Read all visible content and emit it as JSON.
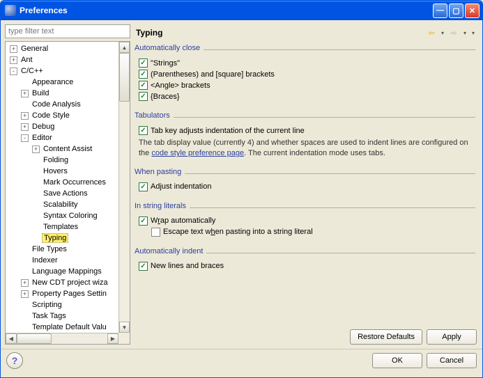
{
  "window": {
    "title": "Preferences"
  },
  "filter": {
    "placeholder": "type filter text"
  },
  "tree": [
    {
      "depth": 0,
      "tw": "+",
      "label": "General"
    },
    {
      "depth": 0,
      "tw": "+",
      "label": "Ant"
    },
    {
      "depth": 0,
      "tw": "-",
      "label": "C/C++"
    },
    {
      "depth": 1,
      "tw": " ",
      "label": "Appearance"
    },
    {
      "depth": 1,
      "tw": "+",
      "label": "Build"
    },
    {
      "depth": 1,
      "tw": " ",
      "label": "Code Analysis"
    },
    {
      "depth": 1,
      "tw": "+",
      "label": "Code Style"
    },
    {
      "depth": 1,
      "tw": "+",
      "label": "Debug"
    },
    {
      "depth": 1,
      "tw": "-",
      "label": "Editor"
    },
    {
      "depth": 2,
      "tw": "+",
      "label": "Content Assist"
    },
    {
      "depth": 2,
      "tw": " ",
      "label": "Folding"
    },
    {
      "depth": 2,
      "tw": " ",
      "label": "Hovers"
    },
    {
      "depth": 2,
      "tw": " ",
      "label": "Mark Occurrences"
    },
    {
      "depth": 2,
      "tw": " ",
      "label": "Save Actions"
    },
    {
      "depth": 2,
      "tw": " ",
      "label": "Scalability"
    },
    {
      "depth": 2,
      "tw": " ",
      "label": "Syntax Coloring"
    },
    {
      "depth": 2,
      "tw": " ",
      "label": "Templates"
    },
    {
      "depth": 2,
      "tw": " ",
      "label": "Typing",
      "selected": true
    },
    {
      "depth": 1,
      "tw": " ",
      "label": "File Types"
    },
    {
      "depth": 1,
      "tw": " ",
      "label": "Indexer"
    },
    {
      "depth": 1,
      "tw": " ",
      "label": "Language Mappings"
    },
    {
      "depth": 1,
      "tw": "+",
      "label": "New CDT project wiza"
    },
    {
      "depth": 1,
      "tw": "+",
      "label": "Property Pages Settin"
    },
    {
      "depth": 1,
      "tw": " ",
      "label": "Scripting"
    },
    {
      "depth": 1,
      "tw": " ",
      "label": "Task Tags"
    },
    {
      "depth": 1,
      "tw": " ",
      "label": "Template Default Valu"
    }
  ],
  "page": {
    "title": "Typing",
    "groups": {
      "autoclose": {
        "title": "Automatically close",
        "strings": "\"Strings\"",
        "parens": "(Parentheses) and [square] brackets",
        "angle": "<Angle> brackets",
        "braces": "{Braces}"
      },
      "tabs": {
        "title": "Tabulators",
        "tabkey": "Tab key adjusts indentation of the current line",
        "note_a": "The tab display value (currently 4) and whether spaces are used to indent lines are configured on the ",
        "note_link": "code style preference page",
        "note_b": ". The current indentation mode uses tabs."
      },
      "paste": {
        "title": "When pasting",
        "adjust": "Adjust indentation"
      },
      "strlit": {
        "title": "In string literals",
        "wrap_pre": "W",
        "wrap_uchar": "r",
        "wrap_post": "ap automatically",
        "escape_pre": "Escape text w",
        "escape_uchar": "h",
        "escape_post": "en pasting into a string literal"
      },
      "autoindent": {
        "title": "Automatically indent",
        "newlines": "New lines and braces"
      }
    },
    "buttons": {
      "restore": "Restore Defaults",
      "apply": "Apply",
      "ok": "OK",
      "cancel": "Cancel"
    }
  }
}
